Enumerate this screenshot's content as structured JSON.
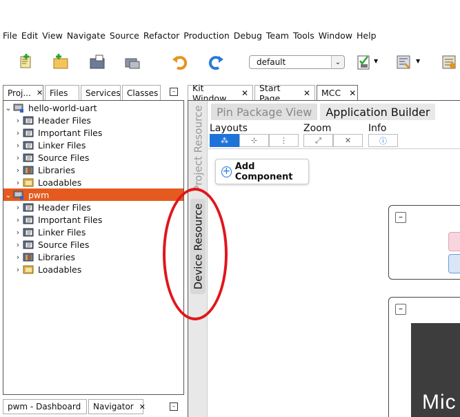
{
  "menubar": [
    "File",
    "Edit",
    "View",
    "Navigate",
    "Source",
    "Refactor",
    "Production",
    "Debug",
    "Team",
    "Tools",
    "Window",
    "Help"
  ],
  "toolbar": {
    "config_value": "default",
    "icons": [
      "new-file-icon",
      "new-project-icon",
      "open-project-icon",
      "close-project-icon",
      "undo-icon",
      "redo-icon",
      "src-check-icon",
      "build-config-icon",
      "project-properties-icon"
    ]
  },
  "left_tabs": [
    {
      "label": "Proj...",
      "close": "✕"
    },
    {
      "label": "Files"
    },
    {
      "label": "Services"
    },
    {
      "label": "Classes"
    }
  ],
  "tree": [
    {
      "label": "hello-world-uart",
      "level": 0,
      "expanded": true,
      "selected": false,
      "icon": "project-icon"
    },
    {
      "label": "Header Files",
      "level": 1,
      "icon": "folder-icon"
    },
    {
      "label": "Important Files",
      "level": 1,
      "icon": "folder-icon"
    },
    {
      "label": "Linker Files",
      "level": 1,
      "icon": "folder-icon"
    },
    {
      "label": "Source Files",
      "level": 1,
      "icon": "folder-icon"
    },
    {
      "label": "Libraries",
      "level": 1,
      "icon": "library-icon"
    },
    {
      "label": "Loadables",
      "level": 1,
      "icon": "loadables-icon"
    },
    {
      "label": "pwm",
      "level": 0,
      "expanded": true,
      "selected": true,
      "icon": "project-icon"
    },
    {
      "label": "Header Files",
      "level": 1,
      "icon": "folder-icon"
    },
    {
      "label": "Important Files",
      "level": 1,
      "icon": "folder-icon"
    },
    {
      "label": "Linker Files",
      "level": 1,
      "icon": "folder-icon"
    },
    {
      "label": "Source Files",
      "level": 1,
      "icon": "folder-icon"
    },
    {
      "label": "Libraries",
      "level": 1,
      "icon": "library-icon"
    },
    {
      "label": "Loadables",
      "level": 1,
      "icon": "loadables-icon"
    }
  ],
  "bottom_tabs": [
    {
      "label": "pwm - Dashboard"
    },
    {
      "label": "Navigator",
      "close": "✕"
    }
  ],
  "editor_tabs": [
    {
      "label": "Kit Window",
      "close": "✕"
    },
    {
      "label": "Start Page",
      "close": "✕"
    },
    {
      "label": "MCC",
      "close": "✕",
      "active": true
    }
  ],
  "mcc": {
    "side_tabs": {
      "project": "Project Resource",
      "device": "Device Resource"
    },
    "tabs": [
      "Pin Package View",
      "Application Builder"
    ],
    "active_tab": "Application Builder",
    "toolbar": {
      "layouts": "Layouts",
      "zoom": "Zoom",
      "info": "Info"
    },
    "add_component": "Add Component",
    "logo_fragment": "Mic"
  },
  "colors": {
    "selection": "#e55a1e",
    "accent": "#1e73d8",
    "annotation": "#e0161b"
  }
}
